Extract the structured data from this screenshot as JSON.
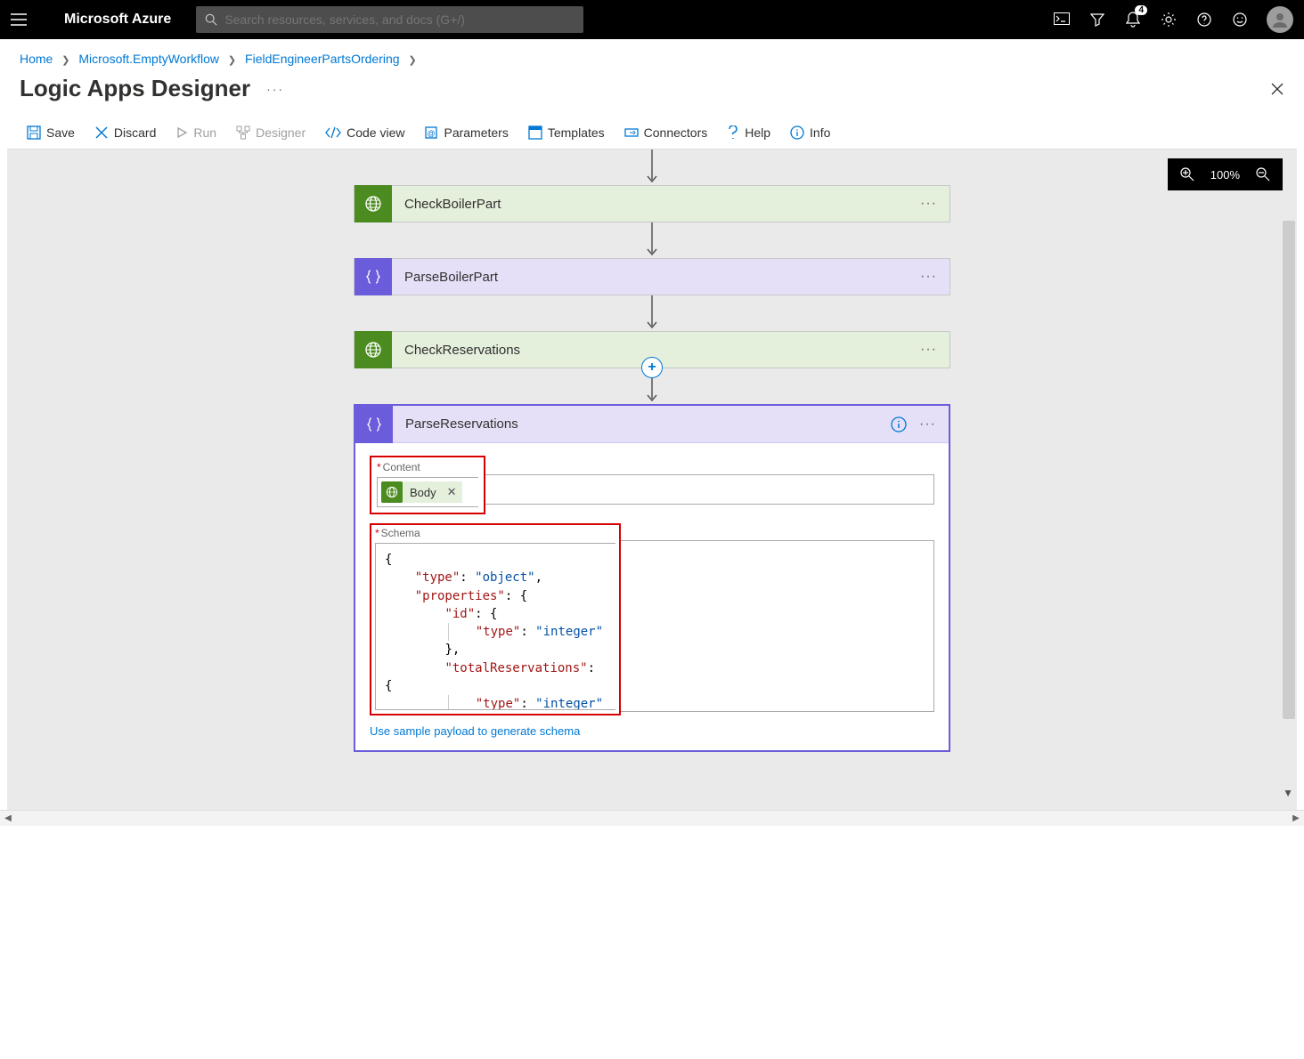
{
  "brand": "Microsoft Azure",
  "search": {
    "placeholder": "Search resources, services, and docs (G+/)"
  },
  "notification_count": "4",
  "breadcrumb": [
    "Home",
    "Microsoft.EmptyWorkflow",
    "FieldEngineerPartsOrdering"
  ],
  "page_title": "Logic Apps Designer",
  "commands": {
    "save": "Save",
    "discard": "Discard",
    "run": "Run",
    "designer": "Designer",
    "codeview": "Code view",
    "parameters": "Parameters",
    "templates": "Templates",
    "connectors": "Connectors",
    "help": "Help",
    "info": "Info"
  },
  "zoom": "100%",
  "cards": {
    "checkBoilerPart": "CheckBoilerPart",
    "parseBoilerPart": "ParseBoilerPart",
    "checkReservations": "CheckReservations",
    "parseReservations": "ParseReservations"
  },
  "expanded": {
    "content_label": "Content",
    "body_token": "Body",
    "schema_label": "Schema",
    "schema_lines": {
      "type": "\"type\"",
      "object": "\"object\"",
      "properties": "\"properties\"",
      "id": "\"id\"",
      "integer": "\"integer\"",
      "totalReservations": "\"totalReservations\""
    },
    "sample_link": "Use sample payload to generate schema"
  }
}
